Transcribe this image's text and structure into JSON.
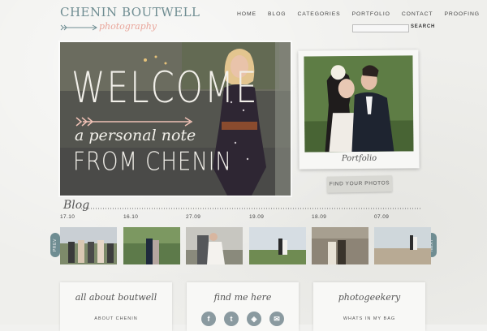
{
  "brand": {
    "name": "CHENIN BOUTWELL",
    "tagline": "photography"
  },
  "nav": {
    "items": [
      "HOME",
      "BLOG",
      "CATEGORIES",
      "PORTFOLIO",
      "CONTACT",
      "PROOFING"
    ],
    "search_placeholder": "",
    "search_label": "SEARCH"
  },
  "hero": {
    "welcome": "WELCOME",
    "note": "a personal note",
    "from": "FROM CHENIN"
  },
  "portfolio": {
    "label": "Portfolio",
    "button": "FIND YOUR PHOTOS"
  },
  "blog": {
    "title": "Blog",
    "dates": [
      "17.10",
      "16.10",
      "27.09",
      "19.09",
      "18.09",
      "07.09"
    ],
    "prev_label": "PREV",
    "next_label": "NEXT"
  },
  "boxes": [
    {
      "title": "all about boutwell",
      "link": "ABOUT CHENIN"
    },
    {
      "title": "find me here",
      "link": ""
    },
    {
      "title": "photogeekery",
      "link": "WHATS IN MY BAG"
    }
  ],
  "social": [
    "facebook-icon",
    "twitter-icon",
    "rss-icon",
    "email-icon"
  ],
  "colors": {
    "accent": "#6f8d92",
    "tagline": "#e9a59a",
    "social": "#8a9aa0"
  }
}
